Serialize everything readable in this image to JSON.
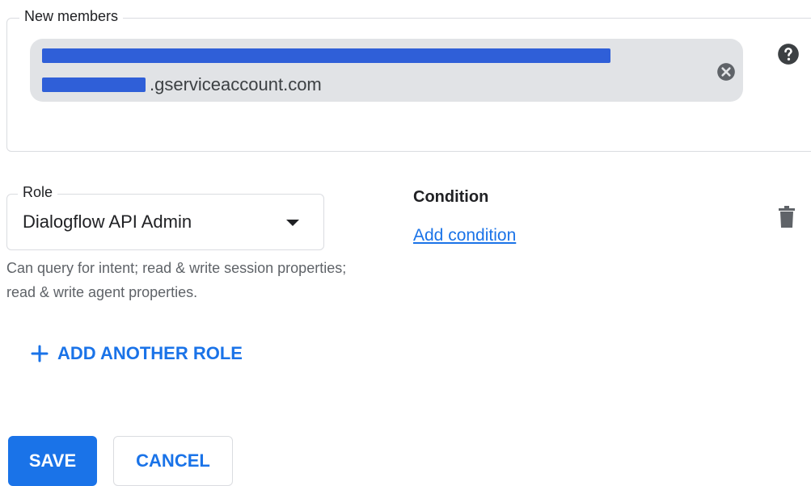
{
  "members": {
    "legend": "New members",
    "chip_text_visible": ".gserviceaccount.com",
    "help_icon": "help-circle-icon",
    "remove_icon": "cancel-circle-icon"
  },
  "role": {
    "legend": "Role",
    "selected": "Dialogflow API Admin",
    "helper_text": "Can query for intent; read & write session properties; read & write agent properties.",
    "dropdown_icon": "caret-down-icon"
  },
  "condition": {
    "label": "Condition",
    "link": "Add condition",
    "delete_icon": "trash-icon"
  },
  "add_role": {
    "label": "ADD ANOTHER ROLE",
    "icon": "plus-icon"
  },
  "actions": {
    "save": "SAVE",
    "cancel": "CANCEL"
  },
  "colors": {
    "accent": "#1a73e8",
    "redaction": "#2f5fd8",
    "chip_bg": "#e1e3e6"
  }
}
